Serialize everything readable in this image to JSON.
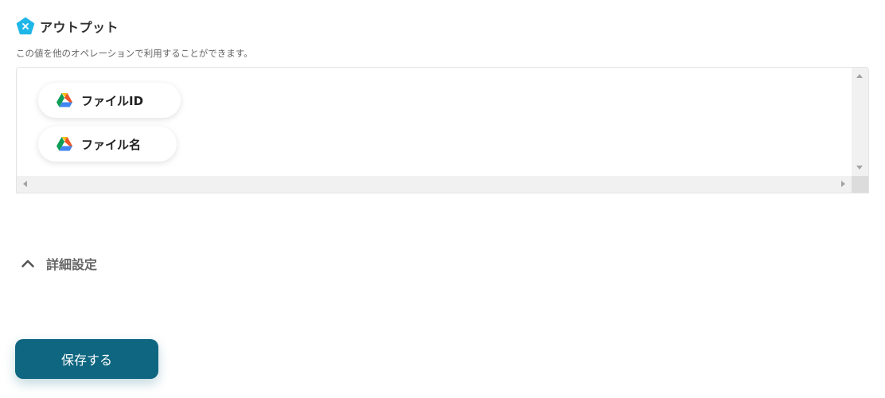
{
  "output": {
    "title": "アウトプット",
    "icon": "x-pentagon-icon",
    "description": "この値を他のオペレーションで利用することができます。",
    "chips": [
      {
        "label": "ファイルID",
        "icon": "google-drive-icon"
      },
      {
        "label": "ファイル名",
        "icon": "google-drive-icon"
      }
    ]
  },
  "advanced": {
    "label": "詳細設定",
    "icon": "chevron-up-icon"
  },
  "save": {
    "label": "保存する"
  },
  "colors": {
    "accent": "#0e6680",
    "icon_blue": "#1fb6e8"
  }
}
